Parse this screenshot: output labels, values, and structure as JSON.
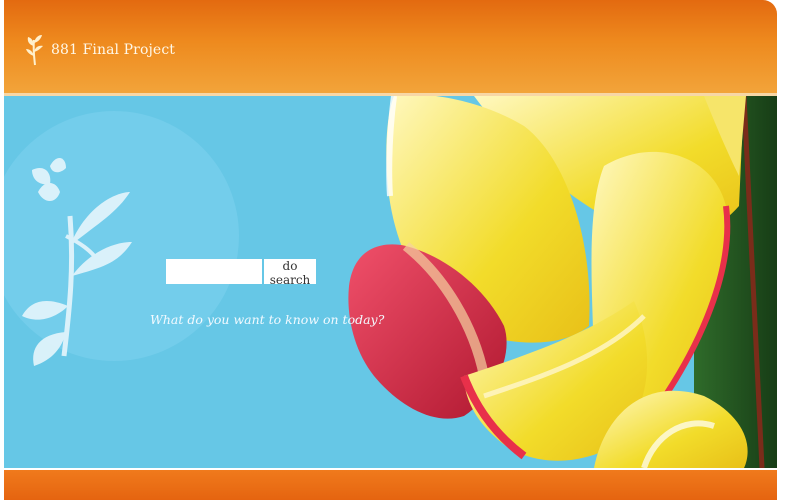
{
  "header": {
    "title": "881 Final Project",
    "logo_icon": "flower-sprig-icon"
  },
  "search": {
    "value": "",
    "placeholder": "",
    "button_label": "do search",
    "tagline": "What do you want to know on today?"
  },
  "colors": {
    "header_orange": "#ee8a1e",
    "hero_blue": "#66c7e6",
    "footer_orange": "#e56410"
  }
}
